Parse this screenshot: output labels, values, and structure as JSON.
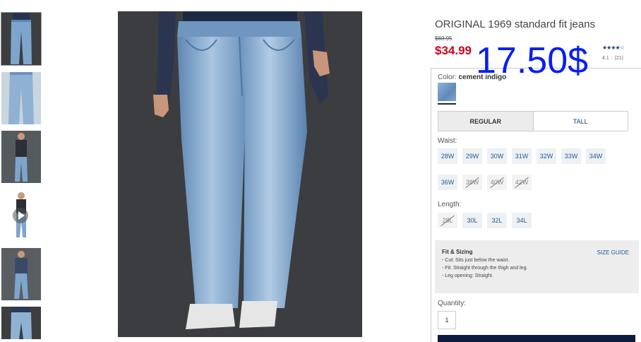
{
  "product": {
    "title": "ORIGINAL 1969 standard fit jeans",
    "original_price": "$60.95",
    "sale_price": "$34.99",
    "overlay_price": "17.50$",
    "stars": "★★★★☆",
    "rating_value": "4.1",
    "review_count": "(21)"
  },
  "color": {
    "label": "Color:",
    "name": "cement indigo"
  },
  "fit_tabs": [
    {
      "label": "REGULAR",
      "selected": true
    },
    {
      "label": "TALL",
      "selected": false
    }
  ],
  "waist": {
    "label": "Waist:",
    "sizes": [
      {
        "label": "28W",
        "available": true
      },
      {
        "label": "29W",
        "available": true
      },
      {
        "label": "30W",
        "available": true
      },
      {
        "label": "31W",
        "available": true
      },
      {
        "label": "32W",
        "available": true
      },
      {
        "label": "33W",
        "available": true
      },
      {
        "label": "34W",
        "available": true
      },
      {
        "label": "36W",
        "available": true
      },
      {
        "label": "38W",
        "available": false
      },
      {
        "label": "40W",
        "available": false
      },
      {
        "label": "42W",
        "available": false
      }
    ]
  },
  "length": {
    "label": "Length:",
    "sizes": [
      {
        "label": "28L",
        "available": false
      },
      {
        "label": "30L",
        "available": true
      },
      {
        "label": "32L",
        "available": true
      },
      {
        "label": "34L",
        "available": true
      }
    ]
  },
  "fit_sizing": {
    "title": "Fit & Sizing",
    "size_guide": "SIZE GUIDE",
    "lines": [
      "- Cut: Sits just below the waist.",
      "- Fit: Straight through the thigh and leg.",
      "- Leg opening: Straight."
    ]
  },
  "quantity": {
    "label": "Quantity:",
    "value": "1"
  },
  "thumbnails": [
    {
      "icon": "jeans-front-thumbnail",
      "selected": true
    },
    {
      "icon": "jeans-detail-thumbnail",
      "selected": false
    },
    {
      "icon": "model-full-body-thumbnail",
      "selected": false
    },
    {
      "icon": "video-play-thumbnail",
      "selected": false
    },
    {
      "icon": "model-walking-thumbnail",
      "selected": false
    },
    {
      "icon": "jeans-back-thumbnail",
      "selected": false
    }
  ],
  "colors": {
    "sale_red": "#d0021b",
    "overlay_blue": "#0a1ff0",
    "link_blue": "#1a5a9c",
    "navy": "#0f1b3d",
    "denim": "#7fa6cf"
  }
}
